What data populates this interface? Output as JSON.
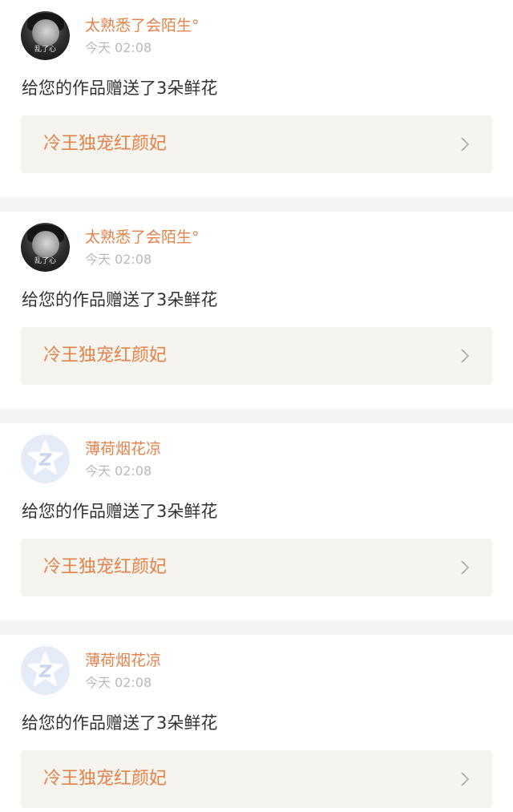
{
  "feed": {
    "items": [
      {
        "username": "太熟悉了会陌生°",
        "time": "今天 02:08",
        "message": "给您的作品赠送了3朵鲜花",
        "work_title": "冷王独宠红颜妃",
        "avatar": "photo-avatar",
        "avatar_text": "乱了心"
      },
      {
        "username": "太熟悉了会陌生°",
        "time": "今天 02:08",
        "message": "给您的作品赠送了3朵鲜花",
        "work_title": "冷王独宠红颜妃",
        "avatar": "photo-avatar",
        "avatar_text": "乱了心"
      },
      {
        "username": "薄荷烟花凉",
        "time": "今天 02:08",
        "message": "给您的作品赠送了3朵鲜花",
        "work_title": "冷王独宠红颜妃",
        "avatar": "default-qzone-avatar-icon"
      },
      {
        "username": "薄荷烟花凉",
        "time": "今天 02:08",
        "message": "给您的作品赠送了3朵鲜花",
        "work_title": "冷王独宠红颜妃",
        "avatar": "default-qzone-avatar-icon"
      }
    ]
  },
  "colors": {
    "accent": "#e4824a",
    "timestamp": "#b9b9b9",
    "message": "#333333",
    "link_background": "#f5f4ef",
    "page_background": "#f6f4f3",
    "default_avatar": "#e6ecf7"
  }
}
